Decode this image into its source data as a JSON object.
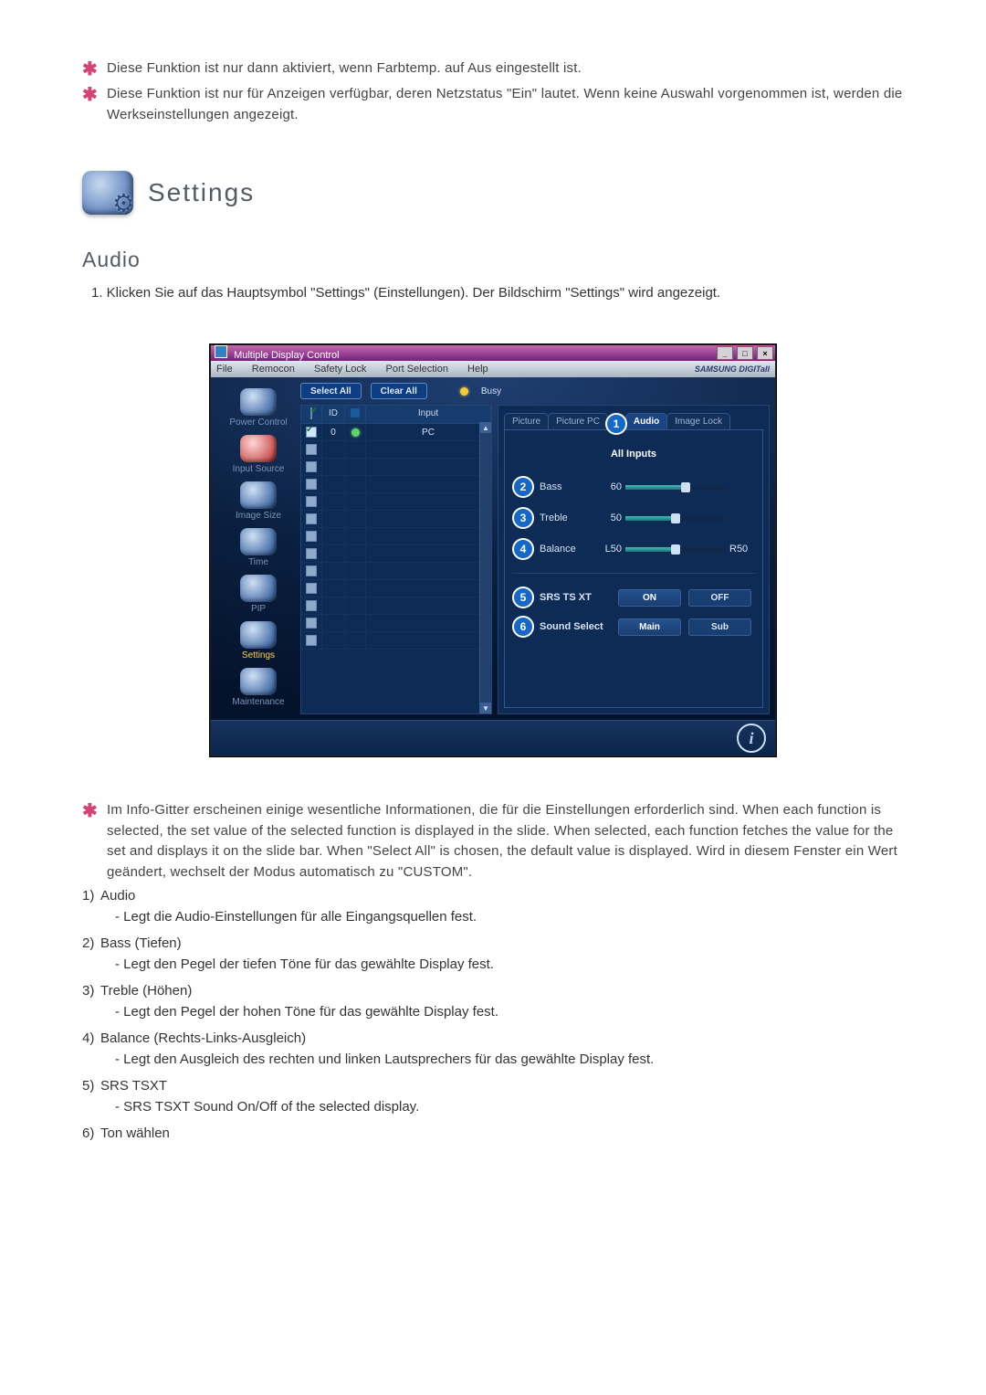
{
  "notes_top": [
    "Diese Funktion ist nur dann aktiviert, wenn Farbtemp. auf Aus eingestellt ist.",
    "Diese Funktion ist nur für Anzeigen verfügbar, deren Netzstatus \"Ein\" lautet. Wenn keine Auswahl vorgenommen ist, werden die Werkseinstellungen angezeigt."
  ],
  "settings_heading": "Settings",
  "audio_heading": "Audio",
  "step1": "1. Klicken Sie auf das Hauptsymbol \"Settings\" (Einstellungen). Der Bildschirm \"Settings\" wird angezeigt.",
  "app": {
    "title": "Multiple Display Control",
    "menus": [
      "File",
      "Remocon",
      "Safety Lock",
      "Port Selection",
      "Help"
    ],
    "brand": "SAMSUNG DIGITall",
    "btn_select_all": "Select All",
    "btn_clear_all": "Clear All",
    "busy_label": "Busy",
    "sidebar": [
      {
        "label": "Power Control"
      },
      {
        "label": "Input Source"
      },
      {
        "label": "Image Size"
      },
      {
        "label": "Time"
      },
      {
        "label": "PIP"
      },
      {
        "label": "Settings"
      },
      {
        "label": "Maintenance"
      }
    ],
    "grid": {
      "headers": {
        "c1": "✔",
        "c2": "ID",
        "c3": "●",
        "c4": "Input"
      },
      "row0": {
        "id": "0",
        "input": "PC"
      }
    },
    "tabs": [
      "Picture",
      "Picture PC",
      "Audio",
      "Image Lock"
    ],
    "all_inputs": "All Inputs",
    "sliders": {
      "bass": {
        "label": "Bass",
        "value": "60"
      },
      "treble": {
        "label": "Treble",
        "value": "50"
      },
      "balance": {
        "label": "Balance",
        "left": "L50",
        "right": "R50"
      }
    },
    "srs": {
      "label": "SRS TS XT",
      "on": "ON",
      "off": "OFF"
    },
    "sound": {
      "label": "Sound Select",
      "main": "Main",
      "sub": "Sub"
    },
    "markers": {
      "1": "1",
      "2": "2",
      "3": "3",
      "4": "4",
      "5": "5",
      "6": "6"
    }
  },
  "note_mid": "Im Info-Gitter erscheinen einige wesentliche Informationen, die für die Einstellungen erforderlich sind. When each function is selected, the set value of the selected function is displayed in the slide. When selected, each function fetches the value for the set and displays it on the slide bar. When \"Select All\" is chosen, the default value is displayed. Wird in diesem Fenster ein Wert geändert, wechselt der Modus automatisch zu \"CUSTOM\".",
  "items": [
    {
      "num": "1)",
      "title": "Audio",
      "sub": "- Legt die Audio-Einstellungen für alle Eingangsquellen fest."
    },
    {
      "num": "2)",
      "title": "Bass (Tiefen)",
      "sub": "- Legt den Pegel der tiefen Töne für das gewählte Display fest."
    },
    {
      "num": "3)",
      "title": "Treble (Höhen)",
      "sub": "- Legt den Pegel der hohen Töne für das gewählte Display fest."
    },
    {
      "num": "4)",
      "title": "Balance (Rechts-Links-Ausgleich)",
      "sub": "- Legt den Ausgleich des rechten und linken Lautsprechers für das gewählte Display fest."
    },
    {
      "num": "5)",
      "title": "SRS TSXT",
      "sub": "- SRS TSXT Sound On/Off of the selected display."
    },
    {
      "num": "6)",
      "title": "Ton wählen",
      "sub": ""
    }
  ]
}
